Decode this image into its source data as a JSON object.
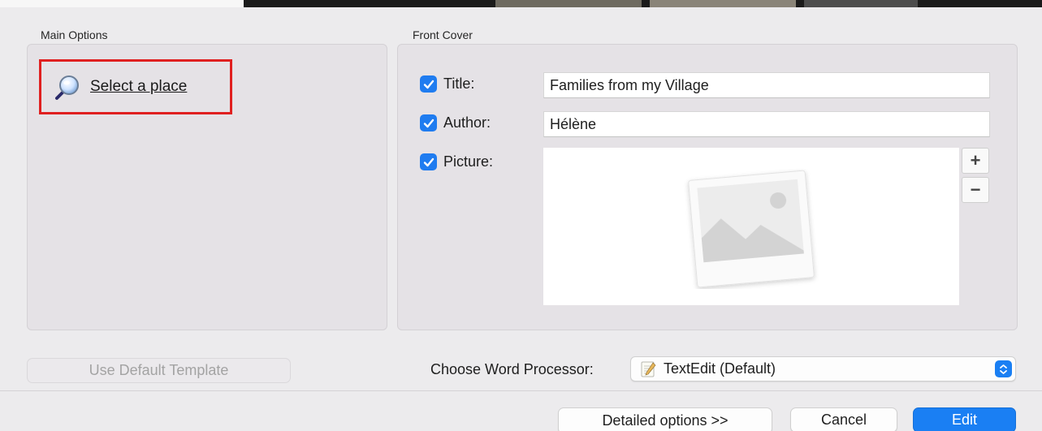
{
  "main_options": {
    "label": "Main Options",
    "select_place_label": "Select a place"
  },
  "front_cover": {
    "label": "Front Cover",
    "title_label": "Title:",
    "title_value": "Families from my Village",
    "author_label": "Author:",
    "author_value": "Hélène",
    "picture_label": "Picture:",
    "add_picture": "+",
    "remove_picture": "−"
  },
  "footer": {
    "default_template_label": "Use Default Template",
    "word_processor_label": "Choose Word Processor:",
    "word_processor_value": "TextEdit (Default)",
    "detailed_options_label": "Detailed options >>",
    "cancel_label": "Cancel",
    "edit_label": "Edit"
  },
  "colors": {
    "accent": "#1a7ff3",
    "highlight_border": "#e02020"
  },
  "icons": {
    "select_place": "magnifier-icon",
    "checkbox": "checkmark-icon",
    "picture_placeholder": "photo-placeholder-icon",
    "word_processor": "textedit-icon",
    "select_arrows": "up-down-chevron-icon"
  }
}
